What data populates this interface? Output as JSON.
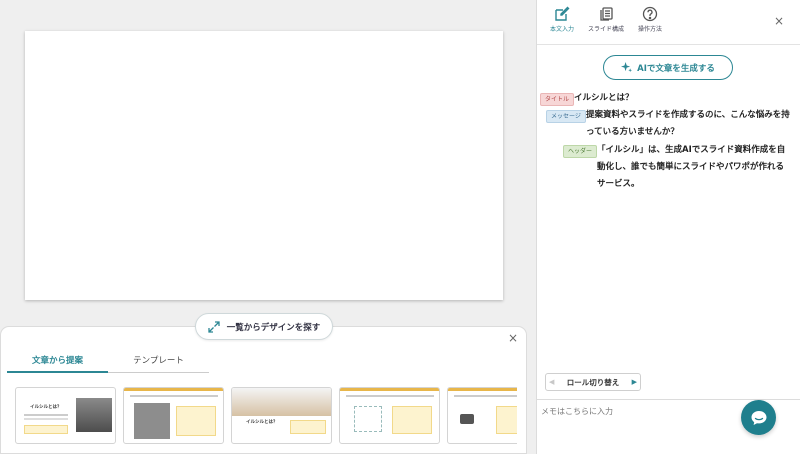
{
  "canvas": {},
  "browse_button": {
    "label": "一覧からデザインを探す"
  },
  "bottom_panel": {
    "tabs": [
      {
        "label": "文章から提案",
        "active": true
      },
      {
        "label": "テンプレート",
        "active": false
      }
    ],
    "close": "×",
    "thumbnails": [
      {
        "heading": "イルシルとは？"
      },
      {
        "heading": ""
      },
      {
        "heading": "イルシルとは？"
      },
      {
        "heading": ""
      },
      {
        "heading": ""
      }
    ]
  },
  "right_panel": {
    "tools": [
      {
        "label": "本文入力",
        "icon": "edit-icon",
        "active": true
      },
      {
        "label": "スライド構成",
        "icon": "copy-icon",
        "active": false
      },
      {
        "label": "操作方法",
        "icon": "help-icon",
        "active": false
      }
    ],
    "close": "×",
    "ai_button": {
      "label": "AIで文章を生成する"
    },
    "entries": [
      {
        "tag": "タイトル",
        "lines": [
          "イルシルとは？"
        ]
      },
      {
        "tag": "メッセージ",
        "lines": [
          "提案資料やスライドを作成するのに、こんな悩みを持",
          "っている方いませんか？"
        ]
      },
      {
        "tag": "ヘッダー",
        "lines": [
          "「イルシル」は、生成AIでスライド資料作成を自",
          "動化し、誰でも簡単にスライドやパワポが作れる",
          "サービス。"
        ]
      }
    ],
    "role_button": {
      "label": "ロール切り替え",
      "prev": "◀",
      "next": "▶"
    },
    "memo": {
      "placeholder": "メモはこちらに入力"
    }
  },
  "colors": {
    "accent": "#2c8794",
    "title_tag": "#f7d6d6",
    "message_tag": "#d8e8f4",
    "header_tag": "#dcebd0",
    "fab": "#1f7f8d"
  }
}
